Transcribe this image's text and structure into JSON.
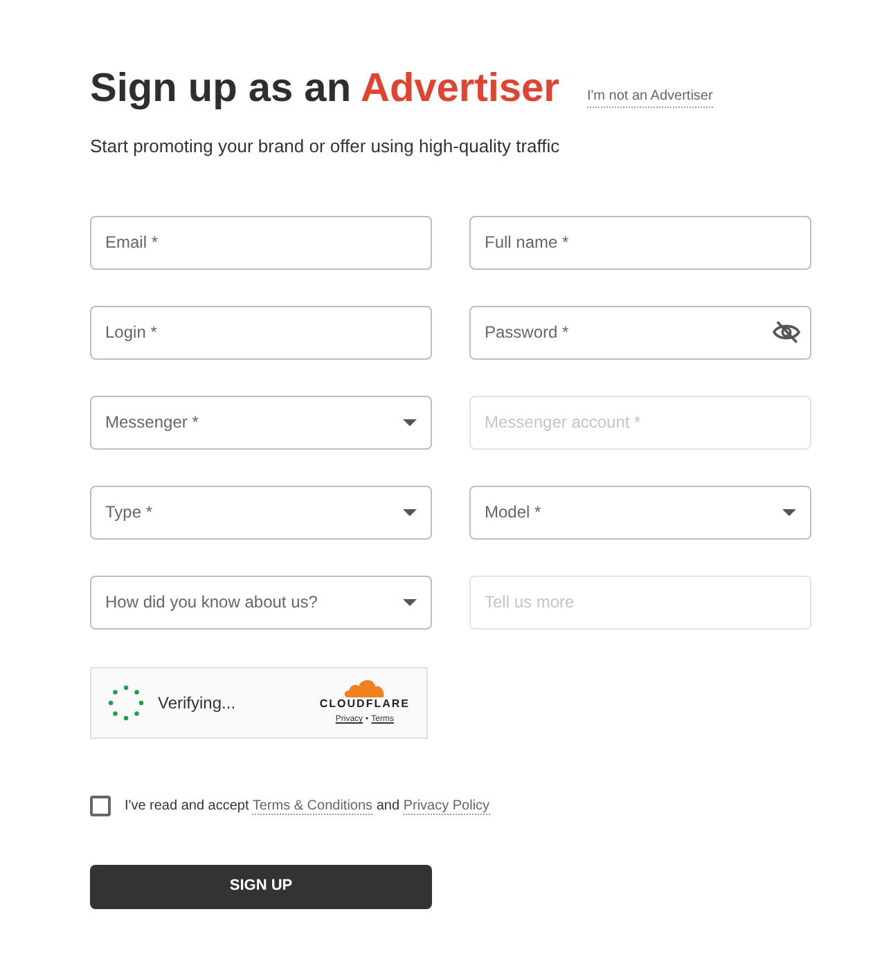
{
  "header": {
    "title_lead": "Sign up as an",
    "title_accent": "Advertiser",
    "switch_link": "I'm not an Advertiser",
    "subtitle": "Start promoting your brand or offer using high-quality traffic"
  },
  "fields": [
    {
      "kind": "text",
      "placeholder": "Email *",
      "disabled": false
    },
    {
      "kind": "text",
      "placeholder": "Full name *",
      "disabled": false
    },
    {
      "kind": "text",
      "placeholder": "Login *",
      "disabled": false
    },
    {
      "kind": "password",
      "placeholder": "Password *",
      "disabled": false
    },
    {
      "kind": "select",
      "placeholder": "Messenger *",
      "disabled": false
    },
    {
      "kind": "text",
      "placeholder": "Messenger account *",
      "disabled": true
    },
    {
      "kind": "select",
      "placeholder": "Type *",
      "disabled": false
    },
    {
      "kind": "select",
      "placeholder": "Model *",
      "disabled": false
    },
    {
      "kind": "select",
      "placeholder": "How did you know about us?",
      "disabled": false
    },
    {
      "kind": "text",
      "placeholder": "Tell us more",
      "disabled": true
    }
  ],
  "captcha": {
    "status": "Verifying...",
    "brand": "CLOUDFLARE",
    "privacy_link": "Privacy",
    "separator": "•",
    "terms_link": "Terms"
  },
  "agreement": {
    "checked": false,
    "text_before": "I've read and accept",
    "terms_link": "Terms & Conditions",
    "conjunction": "and",
    "privacy_link": "Privacy Policy"
  },
  "submit": "SIGN UP"
}
